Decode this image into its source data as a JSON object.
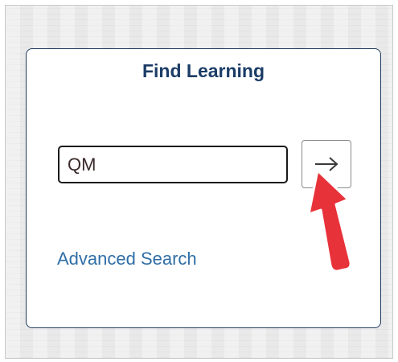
{
  "panel": {
    "title": "Find Learning"
  },
  "search": {
    "value": "QM",
    "go_icon": "arrow-right-icon"
  },
  "links": {
    "advanced_search": "Advanced Search"
  },
  "annotation": {
    "icon": "red-pointer-arrow",
    "color": "#e8323a"
  }
}
